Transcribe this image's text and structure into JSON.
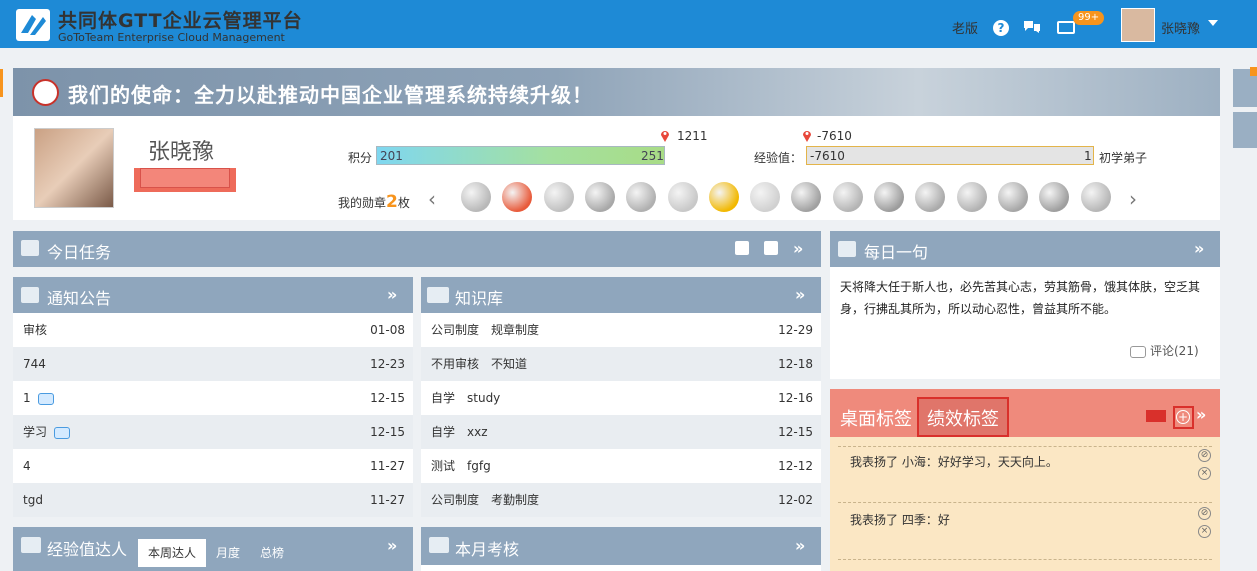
{
  "header": {
    "title": "共同体GTT企业云管理平台",
    "subtitle": "GoToTeam Enterprise Cloud Management",
    "old_version": "老版",
    "help": "?",
    "mail_badge": "99+",
    "user_name": "张晓豫"
  },
  "banner": {
    "mission": "我们的使命：全力以赴推动中国企业管理系统持续升级！"
  },
  "profile": {
    "name": "张晓豫",
    "points_label": "积分",
    "points_current": "201",
    "points_next": "251",
    "points_marker": "1211",
    "exp_label": "经验值：",
    "exp_current": "-7610",
    "exp_next": "1",
    "exp_marker": "-7610",
    "rank": "初学弟子",
    "medals_prefix": "我的勋章",
    "medals_count": "2",
    "medals_suffix": "枚",
    "medal_prev": "‹",
    "medal_next": "›"
  },
  "today_tasks": {
    "title": "今日任务",
    "more": "»"
  },
  "notices": {
    "title": "通知公告",
    "more": "»",
    "rows": [
      {
        "text": "审核",
        "date": "01-08",
        "comment": false
      },
      {
        "text": "744",
        "date": "12-23",
        "comment": false
      },
      {
        "text": "1",
        "date": "12-15",
        "comment": true
      },
      {
        "text": "学习",
        "date": "12-15",
        "comment": true
      },
      {
        "text": "4",
        "date": "11-27",
        "comment": false
      },
      {
        "text": "tgd",
        "date": "11-27",
        "comment": false
      }
    ]
  },
  "knowledge": {
    "title": "知识库",
    "more": "»",
    "rows": [
      {
        "category": "公司制度",
        "text": "规章制度",
        "date": "12-29"
      },
      {
        "category": "不用审核",
        "text": "不知道",
        "date": "12-18"
      },
      {
        "category": "自学",
        "text": "study",
        "date": "12-16"
      },
      {
        "category": "自学",
        "text": "xxz",
        "date": "12-15"
      },
      {
        "category": "测试",
        "text": "fgfg",
        "date": "12-12"
      },
      {
        "category": "公司制度",
        "text": "考勤制度",
        "date": "12-02"
      }
    ]
  },
  "daily_quote": {
    "title": "每日一句",
    "more": "»",
    "text": "天将降大任于斯人也，必先苦其心志，劳其筋骨，饿其体肤，空乏其身，行拂乱其所为，所以动心忍性，曾益其所不能。",
    "comments": "评论(21)"
  },
  "tags": {
    "tab_desktop": "桌面标签",
    "tab_performance": "绩效标签",
    "more": "»",
    "add": "+",
    "items": [
      {
        "text": "我表扬了 小海：好好学习，天天向上。"
      },
      {
        "text": "我表扬了 四季：好"
      }
    ]
  },
  "exp_masters": {
    "title": "经验值达人",
    "more": "»",
    "tabs": [
      "本周达人",
      "月度",
      "总榜"
    ]
  },
  "monthly_review": {
    "title": "本月考核",
    "more": "»"
  }
}
